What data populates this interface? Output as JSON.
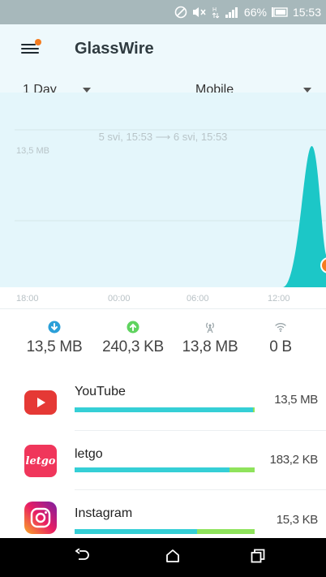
{
  "status_bar": {
    "battery": "66%",
    "time": "15:53"
  },
  "header": {
    "title": "GlassWire"
  },
  "filters": {
    "period": "1 Day",
    "network": "Mobile"
  },
  "chart_data": {
    "type": "area",
    "title": "",
    "range_label": "5 svi, 15:53 ⟶ 6 svi, 15:53",
    "y_tick_label": "13,5 MB",
    "x_tick_labels": [
      "18:00",
      "00:00",
      "06:00",
      "12:00"
    ],
    "series": [
      {
        "values_mb": [
          0,
          0,
          0,
          0,
          0,
          0,
          0,
          0,
          0,
          0,
          0,
          13.5,
          0
        ]
      }
    ],
    "grid": true,
    "accent_color": "#1cc7c7",
    "marker_color": "#f57c1f"
  },
  "stats": [
    {
      "icon": "download-icon",
      "value": "13,5 MB",
      "color": "#2a9fd8"
    },
    {
      "icon": "upload-icon",
      "value": "240,3 KB",
      "color": "#5fd35f"
    },
    {
      "icon": "mobile-antenna-icon",
      "value": "13,8 MB",
      "color": "#9aa5a9"
    },
    {
      "icon": "wifi-icon",
      "value": "0 B",
      "color": "#9aa5a9"
    }
  ],
  "apps": [
    {
      "name": "YouTube",
      "size": "13,5 MB",
      "download_fraction": 0.99,
      "upload_fraction": 0.01
    },
    {
      "name": "letgo",
      "size": "183,2 KB",
      "download_fraction": 0.86,
      "upload_fraction": 0.14
    },
    {
      "name": "Instagram",
      "size": "15,3 KB",
      "download_fraction": 0.68,
      "upload_fraction": 0.32
    }
  ],
  "app_logos": {
    "letgo_text": "letgo"
  }
}
